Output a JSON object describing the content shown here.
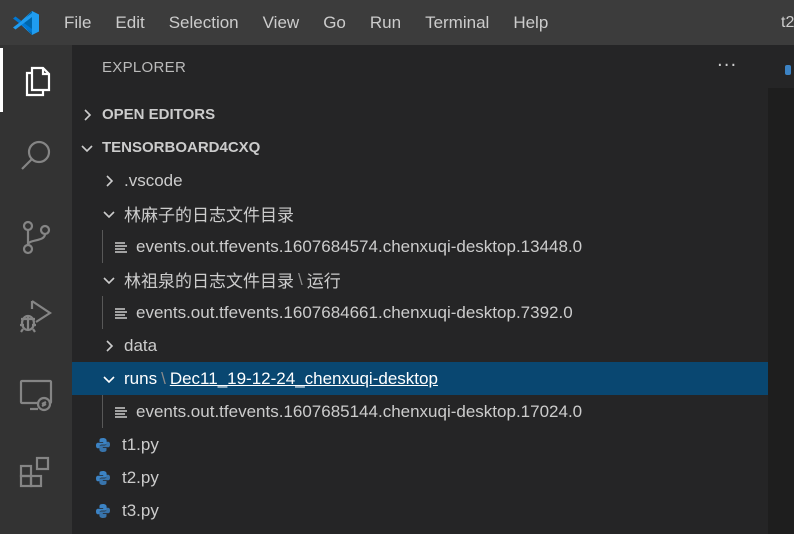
{
  "window": {
    "title": "t2"
  },
  "menu": [
    "File",
    "Edit",
    "Selection",
    "View",
    "Go",
    "Run",
    "Terminal",
    "Help"
  ],
  "activity_bar": [
    {
      "icon": "files-icon",
      "active": true
    },
    {
      "icon": "search-icon",
      "active": false
    },
    {
      "icon": "source-control-icon",
      "active": false
    },
    {
      "icon": "run-debug-icon",
      "active": false
    },
    {
      "icon": "remote-explorer-icon",
      "active": false
    },
    {
      "icon": "extensions-icon",
      "active": false
    }
  ],
  "explorer": {
    "header": "EXPLORER",
    "more": "···",
    "open_editors": "OPEN EDITORS",
    "workspace": "TENSORBOARD4CXQ",
    "tree": [
      {
        "label": ".vscode",
        "kind": "folder",
        "expanded": false
      },
      {
        "label": "林麻子的日志文件目录",
        "kind": "folder",
        "expanded": true
      },
      {
        "label": "events.out.tfevents.1607684574.chenxuqi-desktop.13448.0",
        "kind": "file"
      },
      {
        "label": "林祖泉的日志文件目录",
        "sep": "\\",
        "label2": "运行",
        "kind": "folder",
        "expanded": true
      },
      {
        "label": "events.out.tfevents.1607684661.chenxuqi-desktop.7392.0",
        "kind": "file"
      },
      {
        "label": "data",
        "kind": "folder",
        "expanded": false
      },
      {
        "label": "runs",
        "sep": "\\",
        "label2": "Dec11_19-12-24_chenxuqi-desktop",
        "kind": "folder",
        "expanded": true,
        "selected": true
      },
      {
        "label": "events.out.tfevents.1607685144.chenxuqi-desktop.17024.0",
        "kind": "file"
      },
      {
        "label": "t1.py",
        "kind": "python"
      },
      {
        "label": "t2.py",
        "kind": "python"
      },
      {
        "label": "t3.py",
        "kind": "python"
      }
    ]
  },
  "colors": {
    "accent": "#0078d4",
    "selection": "#094771",
    "python_blue": "#3c83c4",
    "python_yellow": "#ffd43b"
  }
}
